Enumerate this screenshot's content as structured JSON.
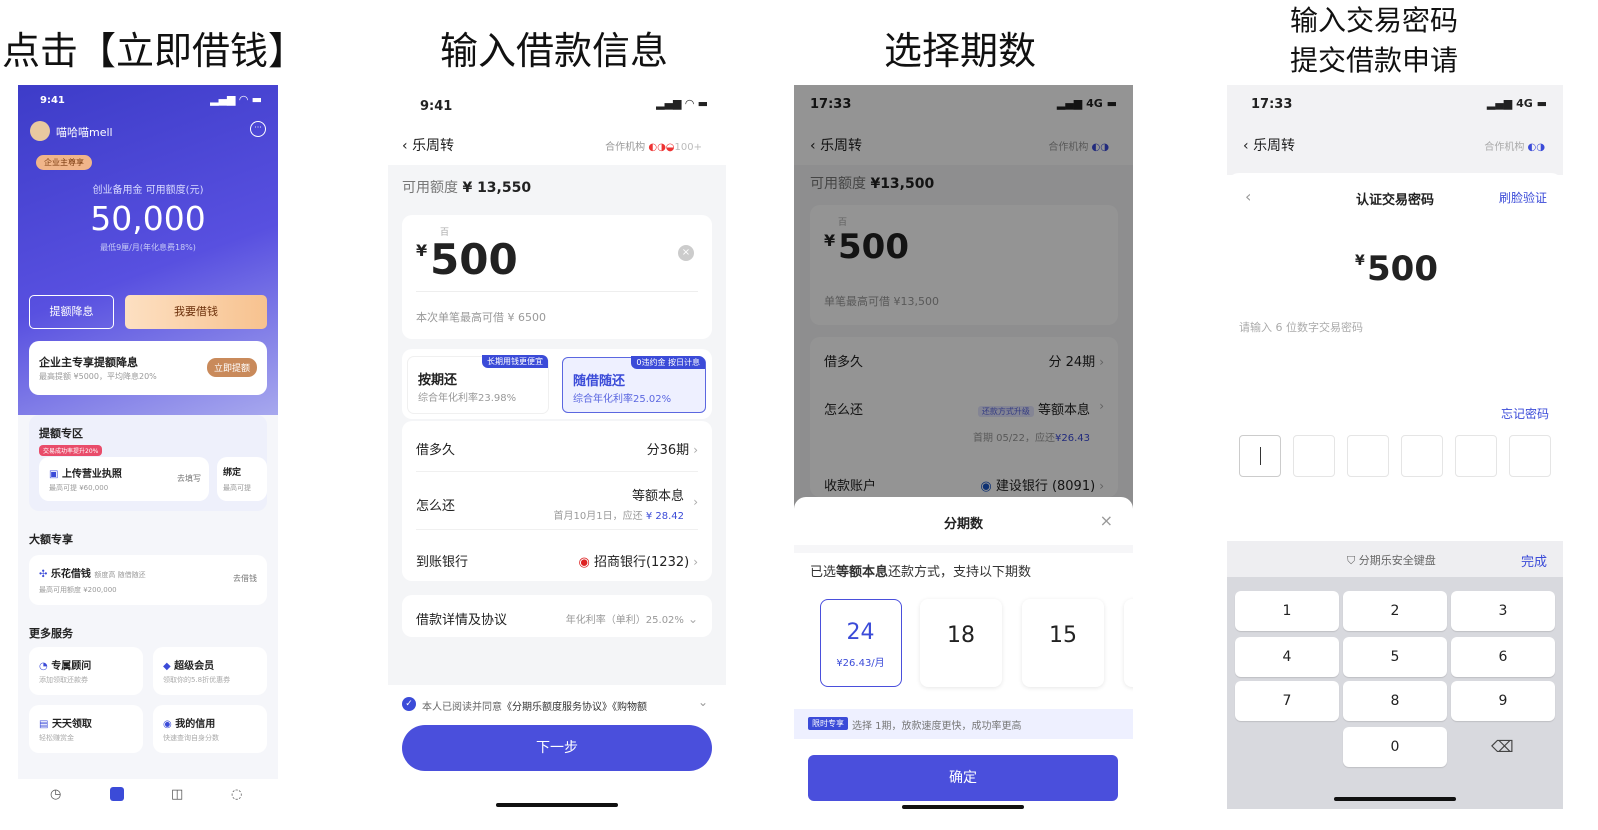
{
  "titles": {
    "t1": "点击【立即借钱】",
    "t2": "输入借款信息",
    "t3": "选择期数",
    "t4a": "输入交易密码",
    "t4b": "提交借款申请"
  },
  "p1": {
    "time": "9:41",
    "user": "喵哈喵mell",
    "badge": "企业主尊享",
    "fund_label": "创业备用金 可用额度(元)",
    "amount": "50,000",
    "rate": "最低9厘/月(年化息费18%)",
    "btn_raise": "提额降息",
    "btn_borrow": "我要借钱",
    "promo_title": "企业主专享提额降息",
    "promo_sub": "最高提额 ¥5000，平均降息20%",
    "promo_btn": "立即提额",
    "zone_title": "提额专区",
    "zone_tag": "交易成功率提升20%",
    "upload_title": "上传营业执照",
    "upload_sub": "最高可提 ¥60,000",
    "upload_act": "去填写",
    "bind_title": "绑定",
    "bind_sub": "最高可提",
    "large_title": "大额专享",
    "lehua_title": "乐花借钱",
    "lehua_tag": "额度高 随借随还",
    "lehua_sub": "最高可用额度 ¥200,000",
    "lehua_act": "去借钱",
    "more_title": "更多服务",
    "s1": "专属顾问",
    "s1s": "添加领取还款券",
    "s2": "超级会员",
    "s2s": "领取你的5.8折优惠券",
    "s3": "天天领取",
    "s3s": "轻松赚赏金",
    "s4": "我的信用",
    "s4s": "快速查询自身分数"
  },
  "p2": {
    "time": "9:41",
    "back": "乐周转",
    "partner": "合作机构",
    "partner_n": "100+",
    "avail_label": "可用额度",
    "avail": "¥ 13,550",
    "unit": "百",
    "currency": "¥",
    "amount": "500",
    "max": "本次单笔最高可借 ¥ 6500",
    "opt1": "按期还",
    "opt1s": "综合年化利率23.98%",
    "opt1tag": "长期用钱更便宜",
    "opt2": "随借随还",
    "opt2s": "综合年化利率25.02%",
    "opt2tag": "0违约金 按日计息",
    "r1l": "借多久",
    "r1v": "分36期",
    "r2l": "怎么还",
    "r2v": "等额本息",
    "r2s": "首月10月1日，应还",
    "r2amt": "¥ 28.42",
    "r3l": "到账银行",
    "r3v": "招商银行(1232)",
    "r4l": "借款详情及协议",
    "r4v": "年化利率（单利）25.02%",
    "agree": "本人已阅读并同意",
    "agree_link": "《分期乐额度服务协议》《购物额",
    "next": "下一步"
  },
  "p3": {
    "time": "17:33",
    "net": "4G",
    "back": "乐周转",
    "partner": "合作机构",
    "avail_label": "可用额度",
    "avail": "¥13,500",
    "unit": "百",
    "currency": "¥",
    "amount": "500",
    "max": "单笔最高可借 ¥13,500",
    "r1l": "借多久",
    "r1v": "分 24期",
    "r2l": "怎么还",
    "r2tag": "还款方式升级",
    "r2v": "等额本息",
    "r2s": "首期 05/22，应还",
    "r2amt": "¥26.43",
    "r3l": "收款账户",
    "r3v": "建设银行 (8091)",
    "sheet_title": "分期数",
    "desc_pre": "已选",
    "desc_b": "等额本息",
    "desc_post": "还款方式，支持以下期数",
    "opt1": "24",
    "opt1s": "¥26.43/月",
    "opt2": "18",
    "opt3": "15",
    "tip_tag": "限时专享",
    "tip": "选择 1期，放款速度更快，成功率更高",
    "confirm": "确定"
  },
  "p4": {
    "time": "17:33",
    "net": "4G",
    "back": "乐周转",
    "partner": "合作机构",
    "title": "认证交易密码",
    "face": "刷脸验证",
    "currency": "¥",
    "amount": "500",
    "hint": "请输入 6 位数字交易密码",
    "forgot": "忘记密码",
    "kb_title": "分期乐安全键盘",
    "done": "完成",
    "keys": [
      "1",
      "2",
      "3",
      "4",
      "5",
      "6",
      "7",
      "8",
      "9",
      "0"
    ]
  }
}
